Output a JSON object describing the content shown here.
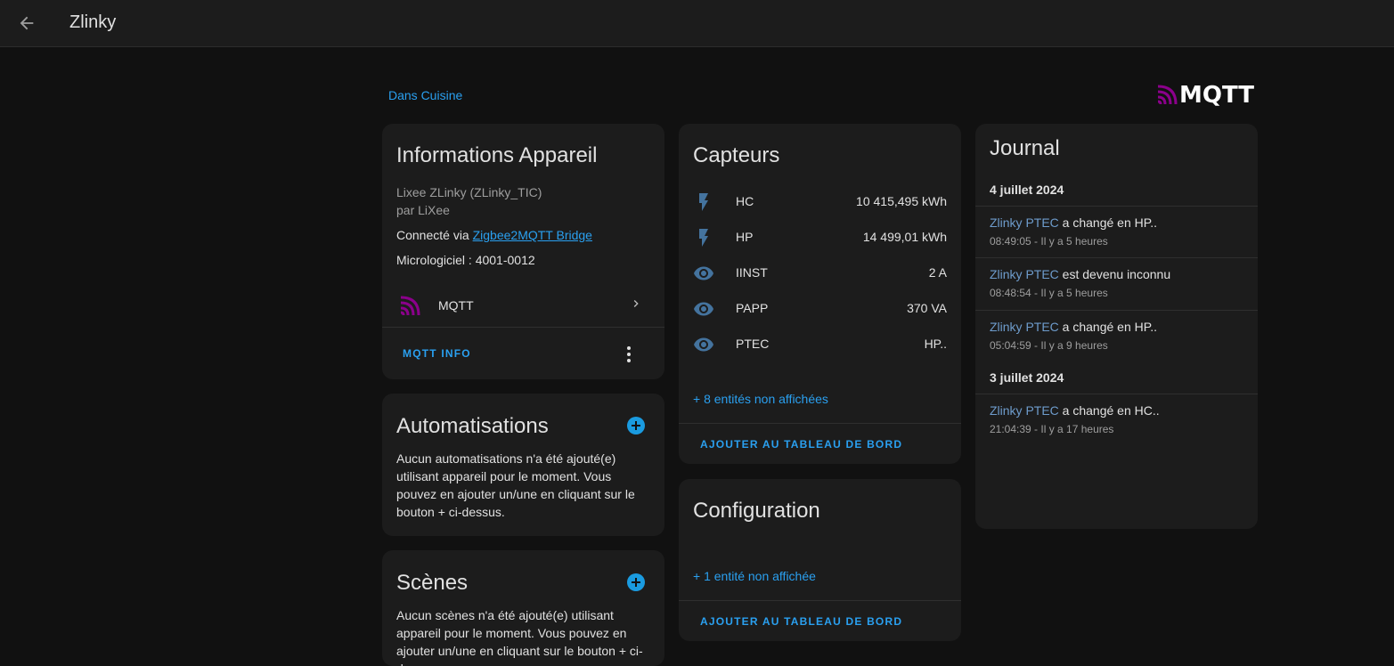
{
  "header": {
    "title": "Zlinky",
    "back_icon": "arrow-left-icon"
  },
  "area_link": "Dans Cuisine",
  "integration_logo": {
    "text": "MQTT",
    "accent": "#8b008b"
  },
  "device_info": {
    "title": "Informations Appareil",
    "model": "Lixee ZLinky (ZLinky_TIC)",
    "manufacturer": "par LiXee",
    "connected_prefix": "Connecté via ",
    "connected_link": "Zigbee2MQTT Bridge",
    "firmware": "Micrologiciel : 4001-0012",
    "integration_label": "MQTT",
    "action_label": "MQTT INFO"
  },
  "automations": {
    "title": "Automatisations",
    "text": "Aucun automatisations n'a été ajouté(e) utilisant appareil pour le moment. Vous pouvez en ajouter un/une en cliquant sur le bouton + ci-dessus."
  },
  "scenes": {
    "title": "Scènes",
    "text": "Aucun scènes n'a été ajouté(e) utilisant appareil pour le moment. Vous pouvez en ajouter un/une en cliquant sur le bouton + ci-dessus."
  },
  "sensors": {
    "title": "Capteurs",
    "rows": [
      {
        "icon": "flash-icon",
        "name": "HC",
        "value": "10 415,495 kWh"
      },
      {
        "icon": "flash-icon",
        "name": "HP",
        "value": "14 499,01 kWh"
      },
      {
        "icon": "eye-icon",
        "name": "IINST",
        "value": "2 A"
      },
      {
        "icon": "eye-icon",
        "name": "PAPP",
        "value": "370 VA"
      },
      {
        "icon": "eye-icon",
        "name": "PTEC",
        "value": "HP.."
      }
    ],
    "hidden_link": "+ 8 entités non affichées",
    "action_label": "AJOUTER AU TABLEAU DE BORD"
  },
  "configuration": {
    "title": "Configuration",
    "hidden_link": "+ 1 entité non affichée",
    "action_label": "AJOUTER AU TABLEAU DE BORD"
  },
  "journal": {
    "title": "Journal",
    "groups": [
      {
        "date": "4 juillet 2024",
        "entries": [
          {
            "entity": "Zlinky PTEC",
            "text": " a changé en HP..",
            "time": "08:49:05 - Il y a 5 heures"
          },
          {
            "entity": "Zlinky PTEC",
            "text": " est devenu inconnu",
            "time": "08:48:54 - Il y a 5 heures"
          },
          {
            "entity": "Zlinky PTEC",
            "text": " a changé en HP..",
            "time": "05:04:59 - Il y a 9 heures"
          }
        ]
      },
      {
        "date": "3 juillet 2024",
        "entries": [
          {
            "entity": "Zlinky PTEC",
            "text": " a changé en HC..",
            "time": "21:04:39 - Il y a 17 heures"
          }
        ]
      }
    ]
  },
  "colors": {
    "accent": "#2aa0f0",
    "background": "#111111",
    "card": "#1c1c1c",
    "icon": "#44739e"
  }
}
